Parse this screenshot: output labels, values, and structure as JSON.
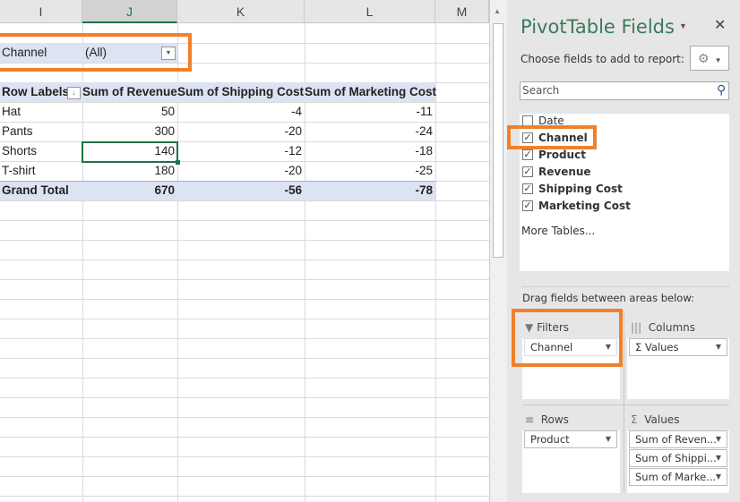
{
  "columns": [
    "I",
    "J",
    "K",
    "L",
    "M"
  ],
  "filter": {
    "label": "Channel",
    "value": "(All)"
  },
  "pivot": {
    "headers": [
      "Row Labels",
      "Sum of Revenue",
      "Sum of Shipping Cost",
      "Sum of Marketing Cost"
    ],
    "rows": [
      {
        "label": "Hat",
        "revenue": "50",
        "shipping": "-4",
        "marketing": "-11"
      },
      {
        "label": "Pants",
        "revenue": "300",
        "shipping": "-20",
        "marketing": "-24"
      },
      {
        "label": "Shorts",
        "revenue": "140",
        "shipping": "-12",
        "marketing": "-18"
      },
      {
        "label": "T-shirt",
        "revenue": "180",
        "shipping": "-20",
        "marketing": "-25"
      }
    ],
    "total": {
      "label": "Grand Total",
      "revenue": "670",
      "shipping": "-56",
      "marketing": "-78"
    }
  },
  "panel": {
    "title": "PivotTable Fields",
    "close": "✕",
    "subtitle": "Choose fields to add to report:",
    "search_placeholder": "Search",
    "fields": [
      {
        "name": "Date",
        "checked": false
      },
      {
        "name": "Channel",
        "checked": true
      },
      {
        "name": "Product",
        "checked": true
      },
      {
        "name": "Revenue",
        "checked": true
      },
      {
        "name": "Shipping Cost",
        "checked": true
      },
      {
        "name": "Marketing Cost",
        "checked": true
      }
    ],
    "more_tables": "More Tables...",
    "drag_label": "Drag fields between areas below:",
    "areas": {
      "filters": {
        "title": "Filters",
        "items": [
          "Channel"
        ]
      },
      "columns": {
        "title": "Columns",
        "items": [
          "Σ Values"
        ]
      },
      "rows": {
        "title": "Rows",
        "items": [
          "Product"
        ]
      },
      "values": {
        "title": "Values",
        "items": [
          "Sum of Reven...",
          "Sum of Shippi...",
          "Sum of Marke..."
        ]
      }
    }
  },
  "colors": {
    "accent": "#217346",
    "highlight": "#f0802a",
    "pivot_band": "#dce3f2"
  }
}
